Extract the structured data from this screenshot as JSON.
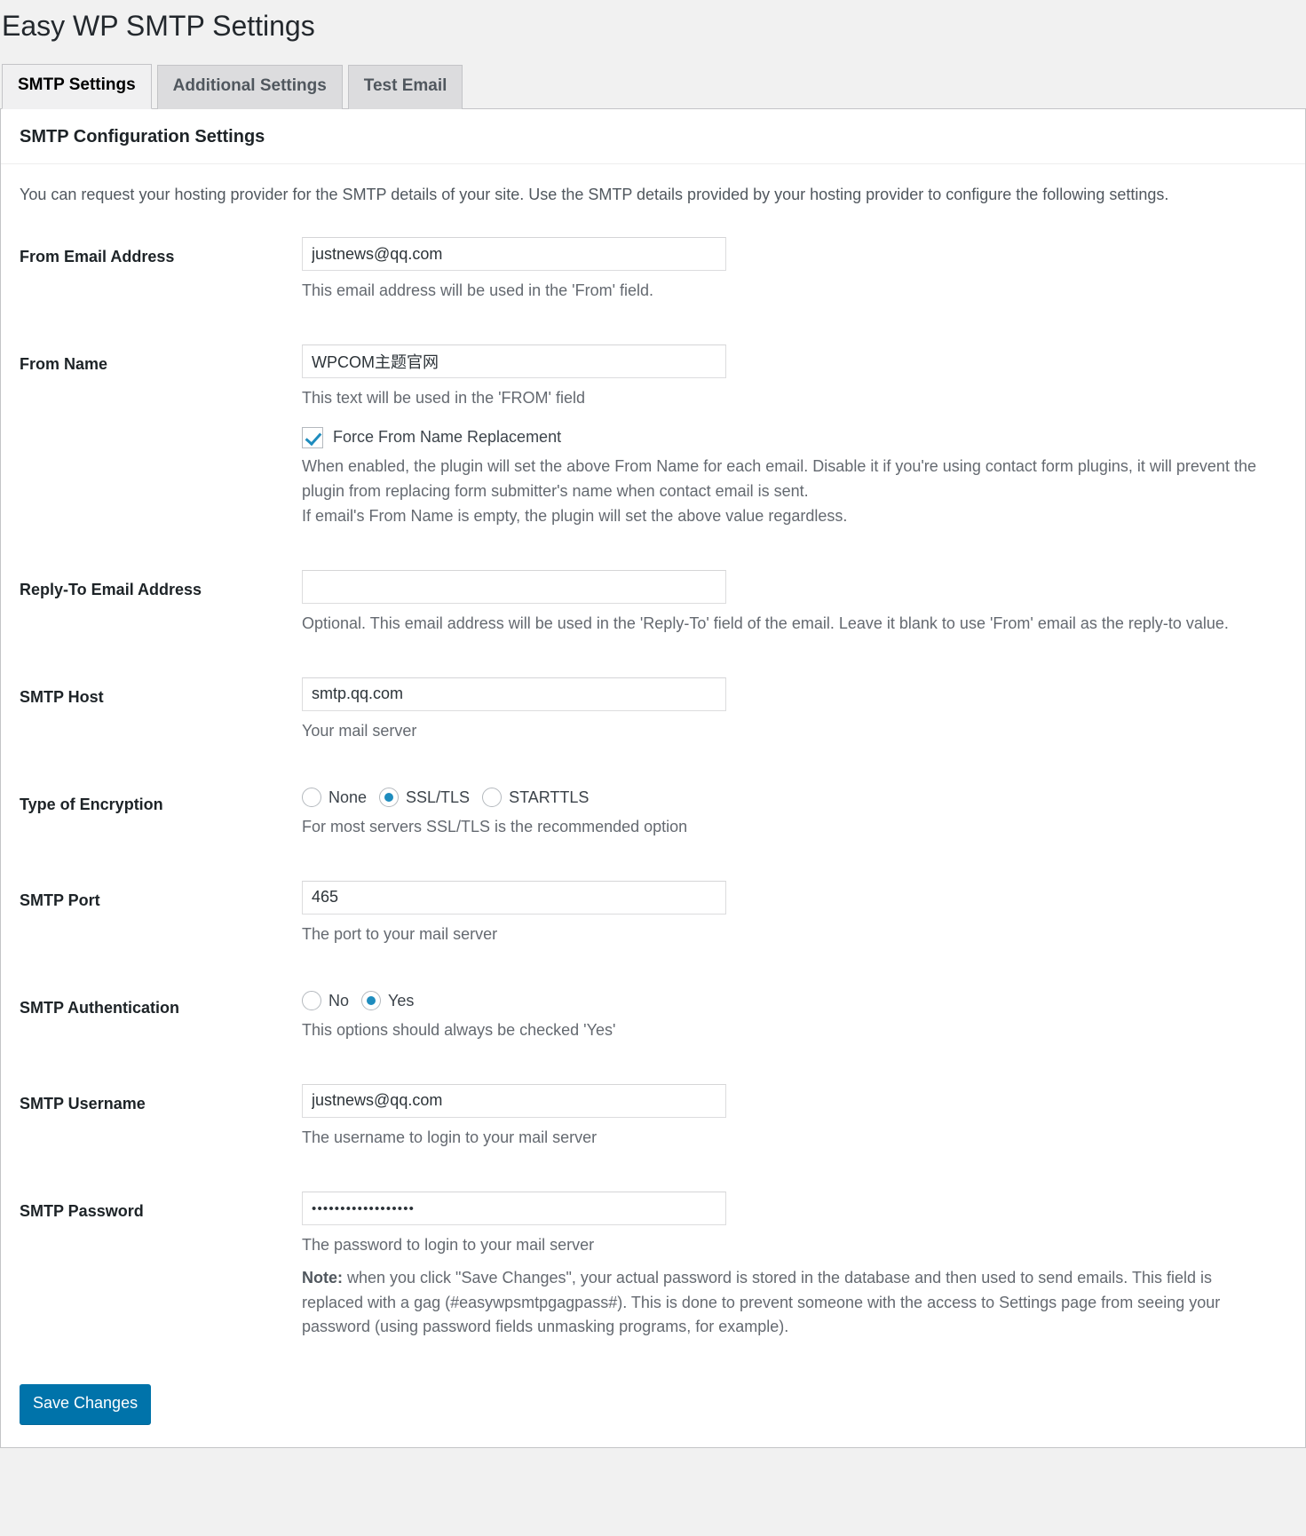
{
  "page": {
    "title": "Easy WP SMTP Settings"
  },
  "tabs": [
    {
      "label": "SMTP Settings",
      "active": true
    },
    {
      "label": "Additional Settings",
      "active": false
    },
    {
      "label": "Test Email",
      "active": false
    }
  ],
  "panel": {
    "heading": "SMTP Configuration Settings",
    "intro": "You can request your hosting provider for the SMTP details of your site. Use the SMTP details provided by your hosting provider to configure the following settings."
  },
  "fields": {
    "from_email": {
      "label": "From Email Address",
      "value": "justnews@qq.com",
      "placeholder": "",
      "description": "This email address will be used in the 'From' field."
    },
    "from_name": {
      "label": "From Name",
      "value": "WPCOM主题官网",
      "placeholder": "",
      "description": "This text will be used in the 'FROM' field",
      "checkbox_label": "Force From Name Replacement",
      "checkbox_checked": true,
      "checkbox_description_line1": "When enabled, the plugin will set the above From Name for each email. Disable it if you're using contact form plugins, it will prevent the plugin from replacing form submitter's name when contact email is sent.",
      "checkbox_description_line2": "If email's From Name is empty, the plugin will set the above value regardless."
    },
    "reply_to": {
      "label": "Reply-To Email Address",
      "value": "",
      "placeholder": "",
      "description": "Optional. This email address will be used in the 'Reply-To' field of the email. Leave it blank to use 'From' email as the reply-to value."
    },
    "smtp_host": {
      "label": "SMTP Host",
      "value": "smtp.qq.com",
      "placeholder": "",
      "description": "Your mail server"
    },
    "encryption": {
      "label": "Type of Encryption",
      "description": "For most servers SSL/TLS is the recommended option",
      "options": [
        {
          "label": "None",
          "selected": false
        },
        {
          "label": "SSL/TLS",
          "selected": true
        },
        {
          "label": "STARTTLS",
          "selected": false
        }
      ]
    },
    "smtp_port": {
      "label": "SMTP Port",
      "value": "465",
      "placeholder": "",
      "description": "The port to your mail server"
    },
    "smtp_auth": {
      "label": "SMTP Authentication",
      "description": "This options should always be checked 'Yes'",
      "options": [
        {
          "label": "No",
          "selected": false
        },
        {
          "label": "Yes",
          "selected": true
        }
      ]
    },
    "smtp_username": {
      "label": "SMTP Username",
      "value": "justnews@qq.com",
      "placeholder": "",
      "description": "The username to login to your mail server"
    },
    "smtp_password": {
      "label": "SMTP Password",
      "value": "••••••••••••••••••",
      "placeholder": "",
      "description": "The password to login to your mail server",
      "note_label": "Note:",
      "note_text": " when you click \"Save Changes\", your actual password is stored in the database and then used to send emails. This field is replaced with a gag (#easywpsmtpgagpass#). This is done to prevent someone with the access to Settings page from seeing your password (using password fields unmasking programs, for example)."
    }
  },
  "submit": {
    "label": "Save Changes"
  },
  "colors": {
    "accent": "#0073aa",
    "control_accent": "#1e8cbe",
    "page_bg": "#f1f1f1",
    "panel_bg": "#ffffff",
    "border": "#c3c4c7"
  }
}
